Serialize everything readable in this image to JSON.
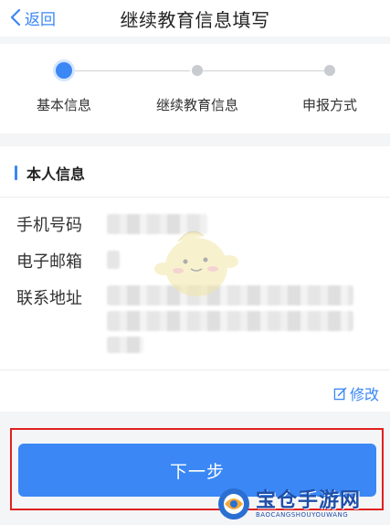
{
  "navbar": {
    "back_label": "返回",
    "title": "继续教育信息填写"
  },
  "steps": {
    "active_index": 0,
    "items": [
      {
        "label": "基本信息"
      },
      {
        "label": "继续教育信息"
      },
      {
        "label": "申报方式"
      }
    ]
  },
  "section": {
    "title": "本人信息",
    "fields": [
      {
        "label": "手机号码"
      },
      {
        "label": "电子邮箱"
      },
      {
        "label": "联系地址"
      }
    ],
    "edit_label": "修改"
  },
  "footer": {
    "next_label": "下一步"
  },
  "watermark": {
    "main_text": "宝仓手游网",
    "sub_text": "BAOCANGSHOUYOUWANG"
  },
  "colors": {
    "accent": "#3a87f5",
    "highlight_frame": "#e02020"
  },
  "icons": {
    "back": "chevron-left-icon",
    "edit": "edit-icon",
    "watermark_logo": "watermark-logo-icon"
  }
}
